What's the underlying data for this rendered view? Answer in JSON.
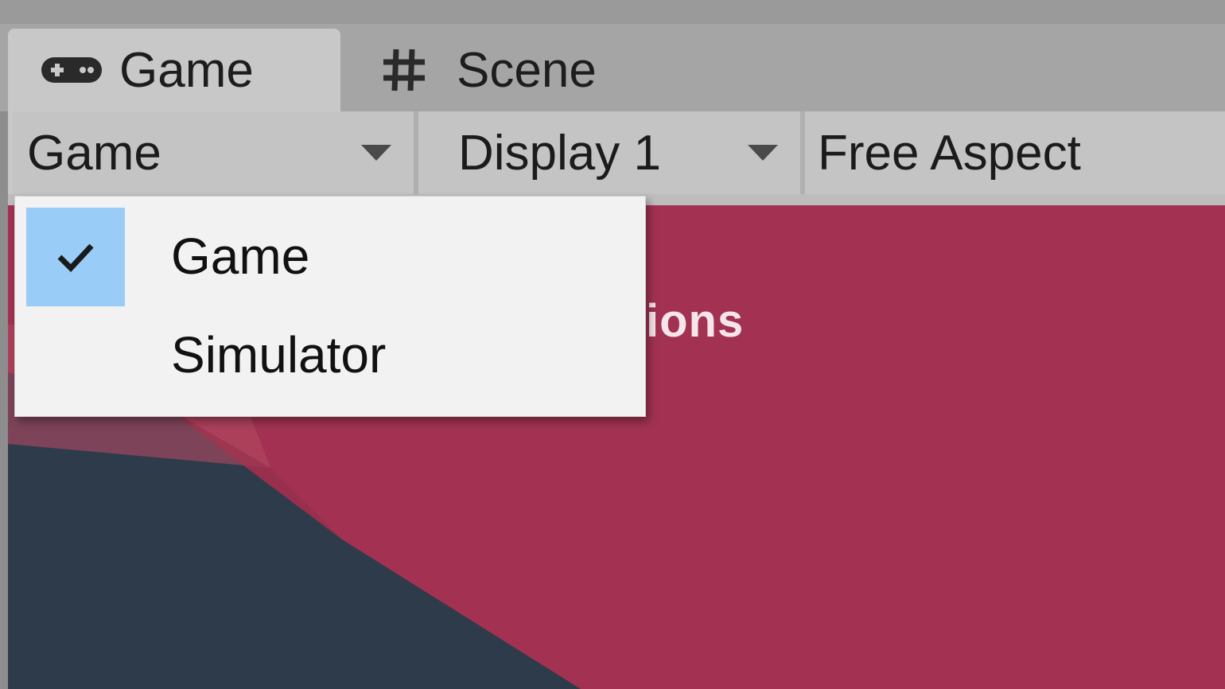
{
  "tabs": [
    {
      "label": "Game",
      "icon": "gamepad-icon",
      "active": true
    },
    {
      "label": "Scene",
      "icon": "grid-hash-icon",
      "active": false
    }
  ],
  "toolbar": {
    "mode_value": "Game",
    "display_value": "Display 1",
    "aspect_value": "Free Aspect"
  },
  "dropdown": {
    "items": [
      {
        "label": "Game",
        "selected": true
      },
      {
        "label": "Simulator",
        "selected": false
      }
    ]
  },
  "game_view": {
    "partial_text": "ions"
  },
  "colors": {
    "active_tab": "#c8c8c8",
    "tab_bar": "#a5a5a5",
    "toolbar": "#c4c4c4",
    "selection_highlight": "#99cdf7",
    "game_background": "#a33252",
    "game_dark_shape": "#2e3b4a"
  }
}
